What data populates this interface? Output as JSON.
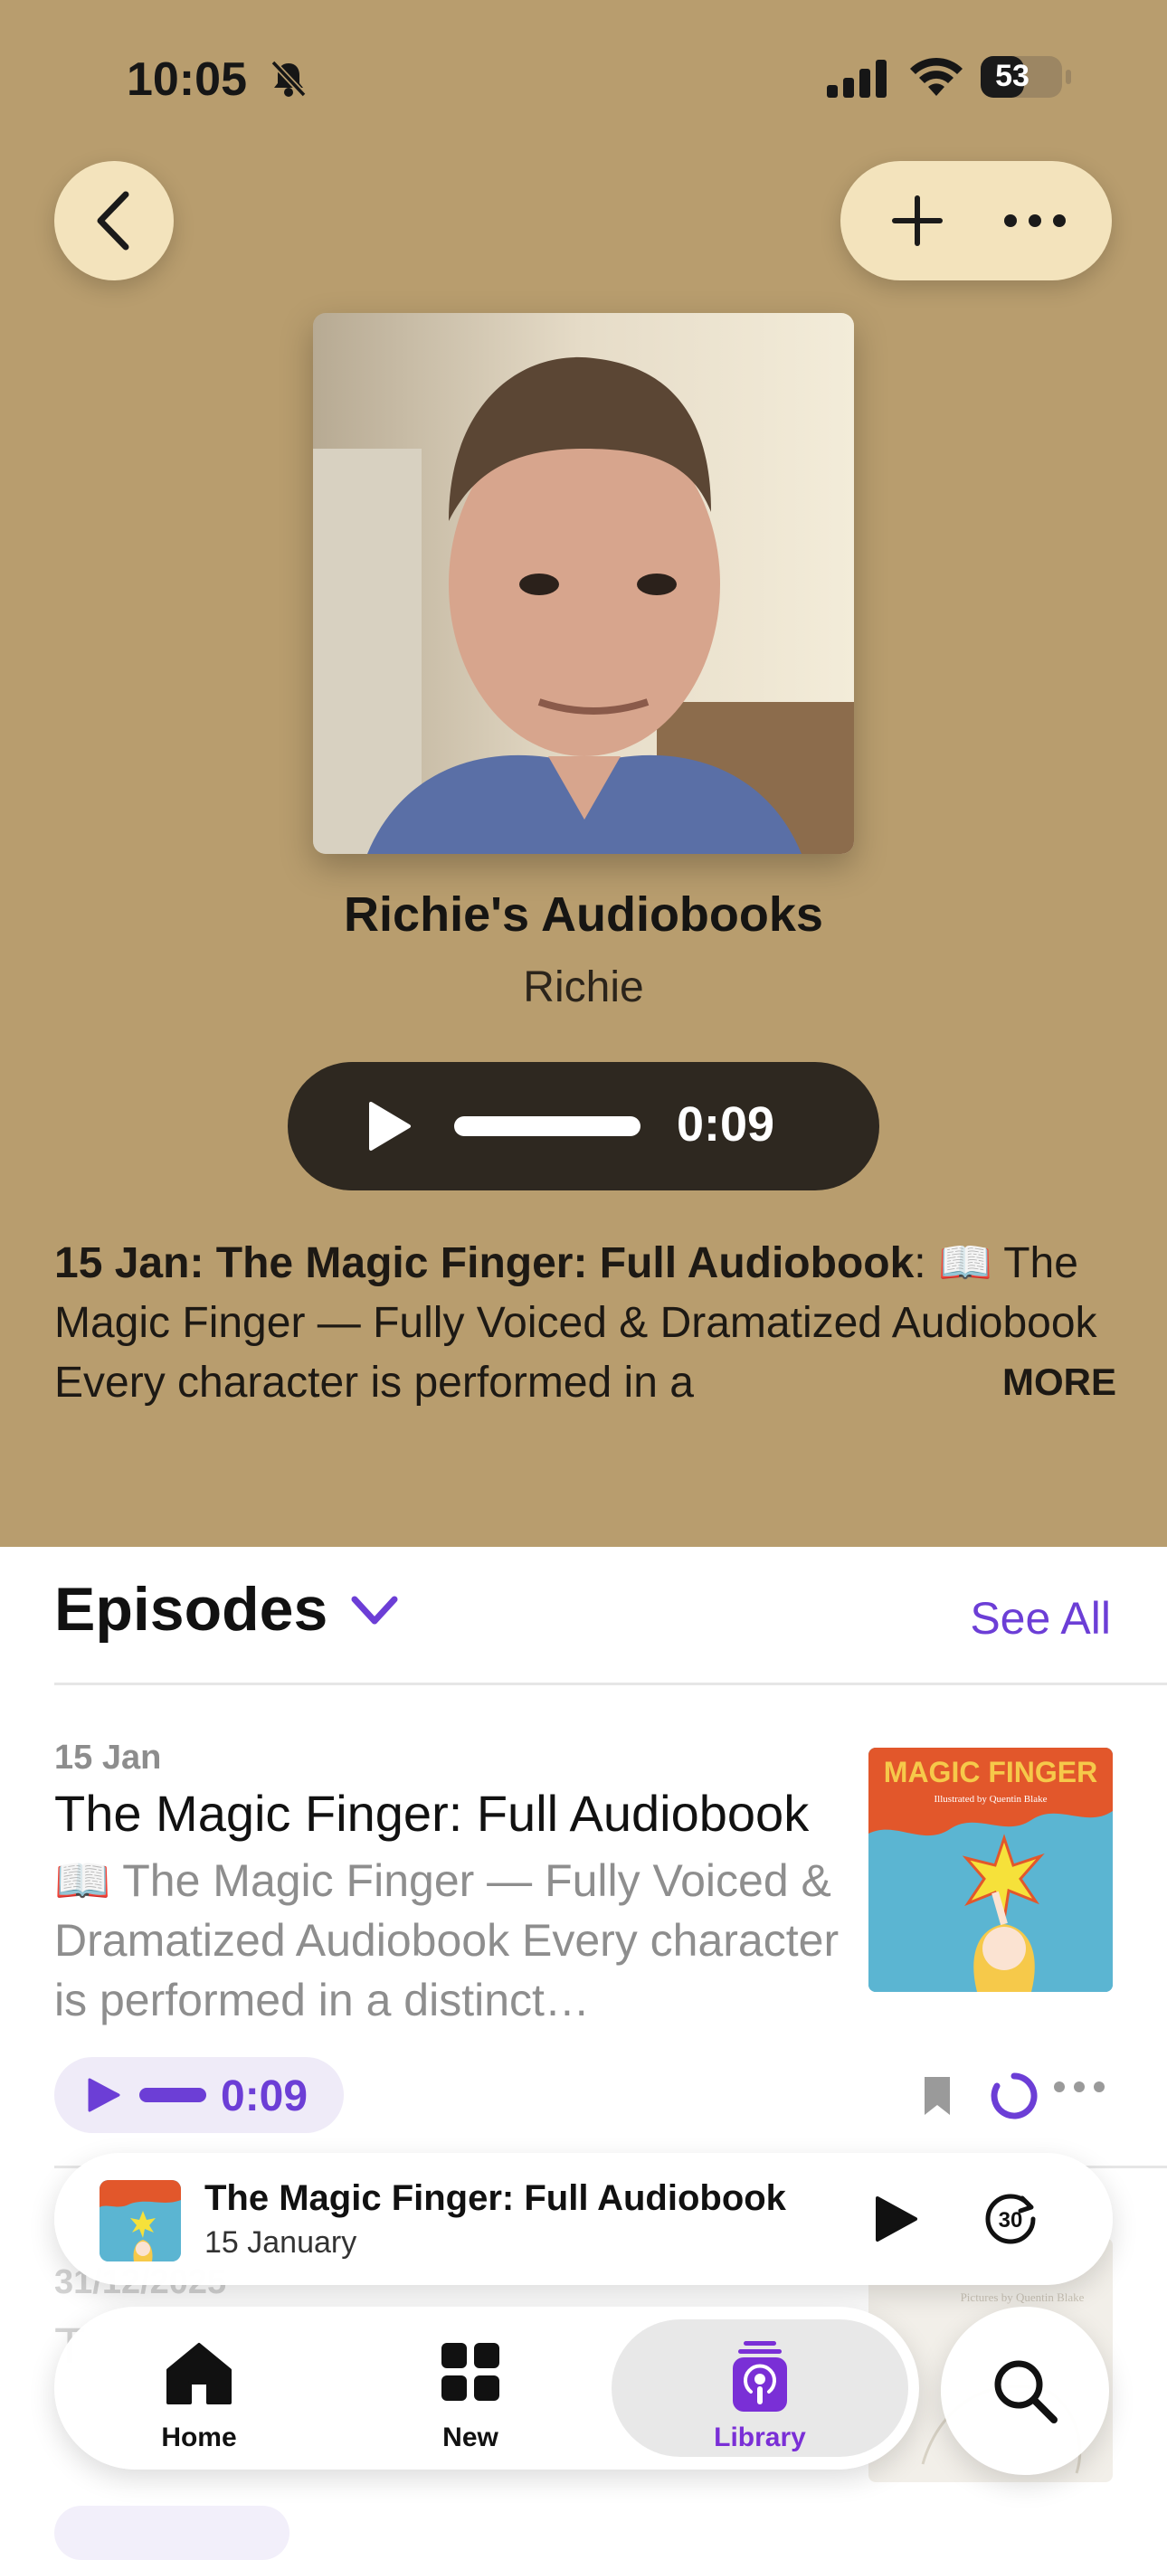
{
  "status_bar": {
    "time": "10:05",
    "battery": "53",
    "battery_level": 0.53
  },
  "header": {
    "back_icon": "chevron-left-icon",
    "add_icon": "plus-icon",
    "more_icon": "ellipsis-icon"
  },
  "show": {
    "title": "Richie's Audiobooks",
    "author": "Richie",
    "play_time": "0:09"
  },
  "description": {
    "bold": "15 Jan: The Magic Finger: Full Audiobook",
    "text": ": 📖 The Magic Finger — Fully Voiced & Dramatized Audiobook  Every character is performed in a",
    "more": "MORE"
  },
  "episodes": {
    "heading": "Episodes",
    "see_all": "See All",
    "items": [
      {
        "date": "15 Jan",
        "title": "The Magic Finger: Full Audiobook",
        "description": "📖 The Magic Finger — Fully Voiced & Dramatized Audiobook  Every character is performed in a distinct…",
        "time": "0:09",
        "thumb_title": "MAGIC FINGER",
        "thumb_sub": "Illustrated by Quentin Blake"
      },
      {
        "date": "31/12/2025",
        "title": "T",
        "thumb_sub": "Pictures by Quentin Blake"
      }
    ]
  },
  "mini_player": {
    "title": "The Magic Finger: Full Audiobook",
    "subtitle": "15 January",
    "skip_label": "30"
  },
  "tabbar": {
    "home": "Home",
    "new": "New",
    "library": "Library"
  },
  "colors": {
    "hero_bg": "#B89D6E",
    "accent": "#6C3ED6",
    "library_accent": "#7a2fd6"
  }
}
